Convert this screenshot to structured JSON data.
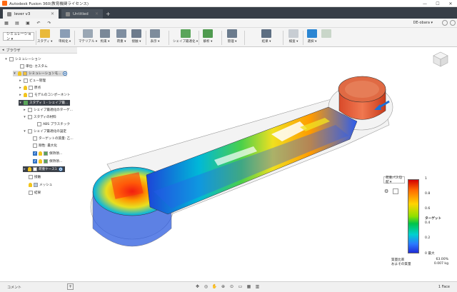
{
  "window": {
    "title": "Autodesk Fusion 360(教育機関ライセンス)",
    "controls": [
      "—",
      "☐",
      "✕"
    ]
  },
  "tabs": [
    {
      "label": "lever v3",
      "active": true
    },
    {
      "label": "Untitled",
      "active": false
    }
  ],
  "quick_access": {
    "user": "DE-obara ▾"
  },
  "ribbon": {
    "workspace": "シミュレーション ▾",
    "groups": [
      "スタディ ▾",
      "単純化 ▾",
      "マテリアル ▾",
      "拘束 ▾",
      "荷重 ▾",
      "接触 ▾",
      "表示 ▾",
      "シェイプ最適化 ▾",
      "解析 ▾",
      "管理 ▾",
      "結果 ▾",
      "検査 ▾",
      "選択 ▾"
    ]
  },
  "browser": {
    "title": "ブラウザ",
    "nodes": [
      {
        "label": "シミュレーション"
      },
      {
        "label": "単位: カスタム"
      },
      {
        "label": "シミュレーションモ..."
      },
      {
        "label": "ビュー管理"
      },
      {
        "label": "原点"
      },
      {
        "label": "モデルのコンポーネント"
      },
      {
        "label": "スタディ 1 - シェイプ最..."
      },
      {
        "label": "シェイプ最適化のターゲ..."
      },
      {
        "label": "スタディの材料"
      },
      {
        "label": "ABS プラスチック"
      },
      {
        "label": "シェイプ最適化の設定"
      },
      {
        "label": "ターゲットの質量: 乙..."
      },
      {
        "label": "剛性: 最大化"
      },
      {
        "label": "保持領..."
      },
      {
        "label": "保持領..."
      },
      {
        "label": "荷重ケース1"
      },
      {
        "label": "接触"
      },
      {
        "label": "メッシュ"
      },
      {
        "label": "結果"
      }
    ]
  },
  "legend": {
    "dropdown": "荷重パス勾配 ▾",
    "ticks": [
      {
        "label": "1",
        "pos": 1.0
      },
      {
        "label": "0.8",
        "pos": 0.8
      },
      {
        "label": "0.6",
        "pos": 0.6
      },
      {
        "label": "ターゲット",
        "pos": 0.47
      },
      {
        "label": "0.4",
        "pos": 0.4
      },
      {
        "label": "0.2",
        "pos": 0.2
      },
      {
        "label": "0 最大",
        "pos": 0.0
      }
    ],
    "stats": [
      {
        "label": "質量比率",
        "value": "63.00%"
      },
      {
        "label": "およその質量",
        "value": "0.007 kg"
      }
    ]
  },
  "statusbar": {
    "comments": "コメント",
    "faces": "1 Face"
  }
}
